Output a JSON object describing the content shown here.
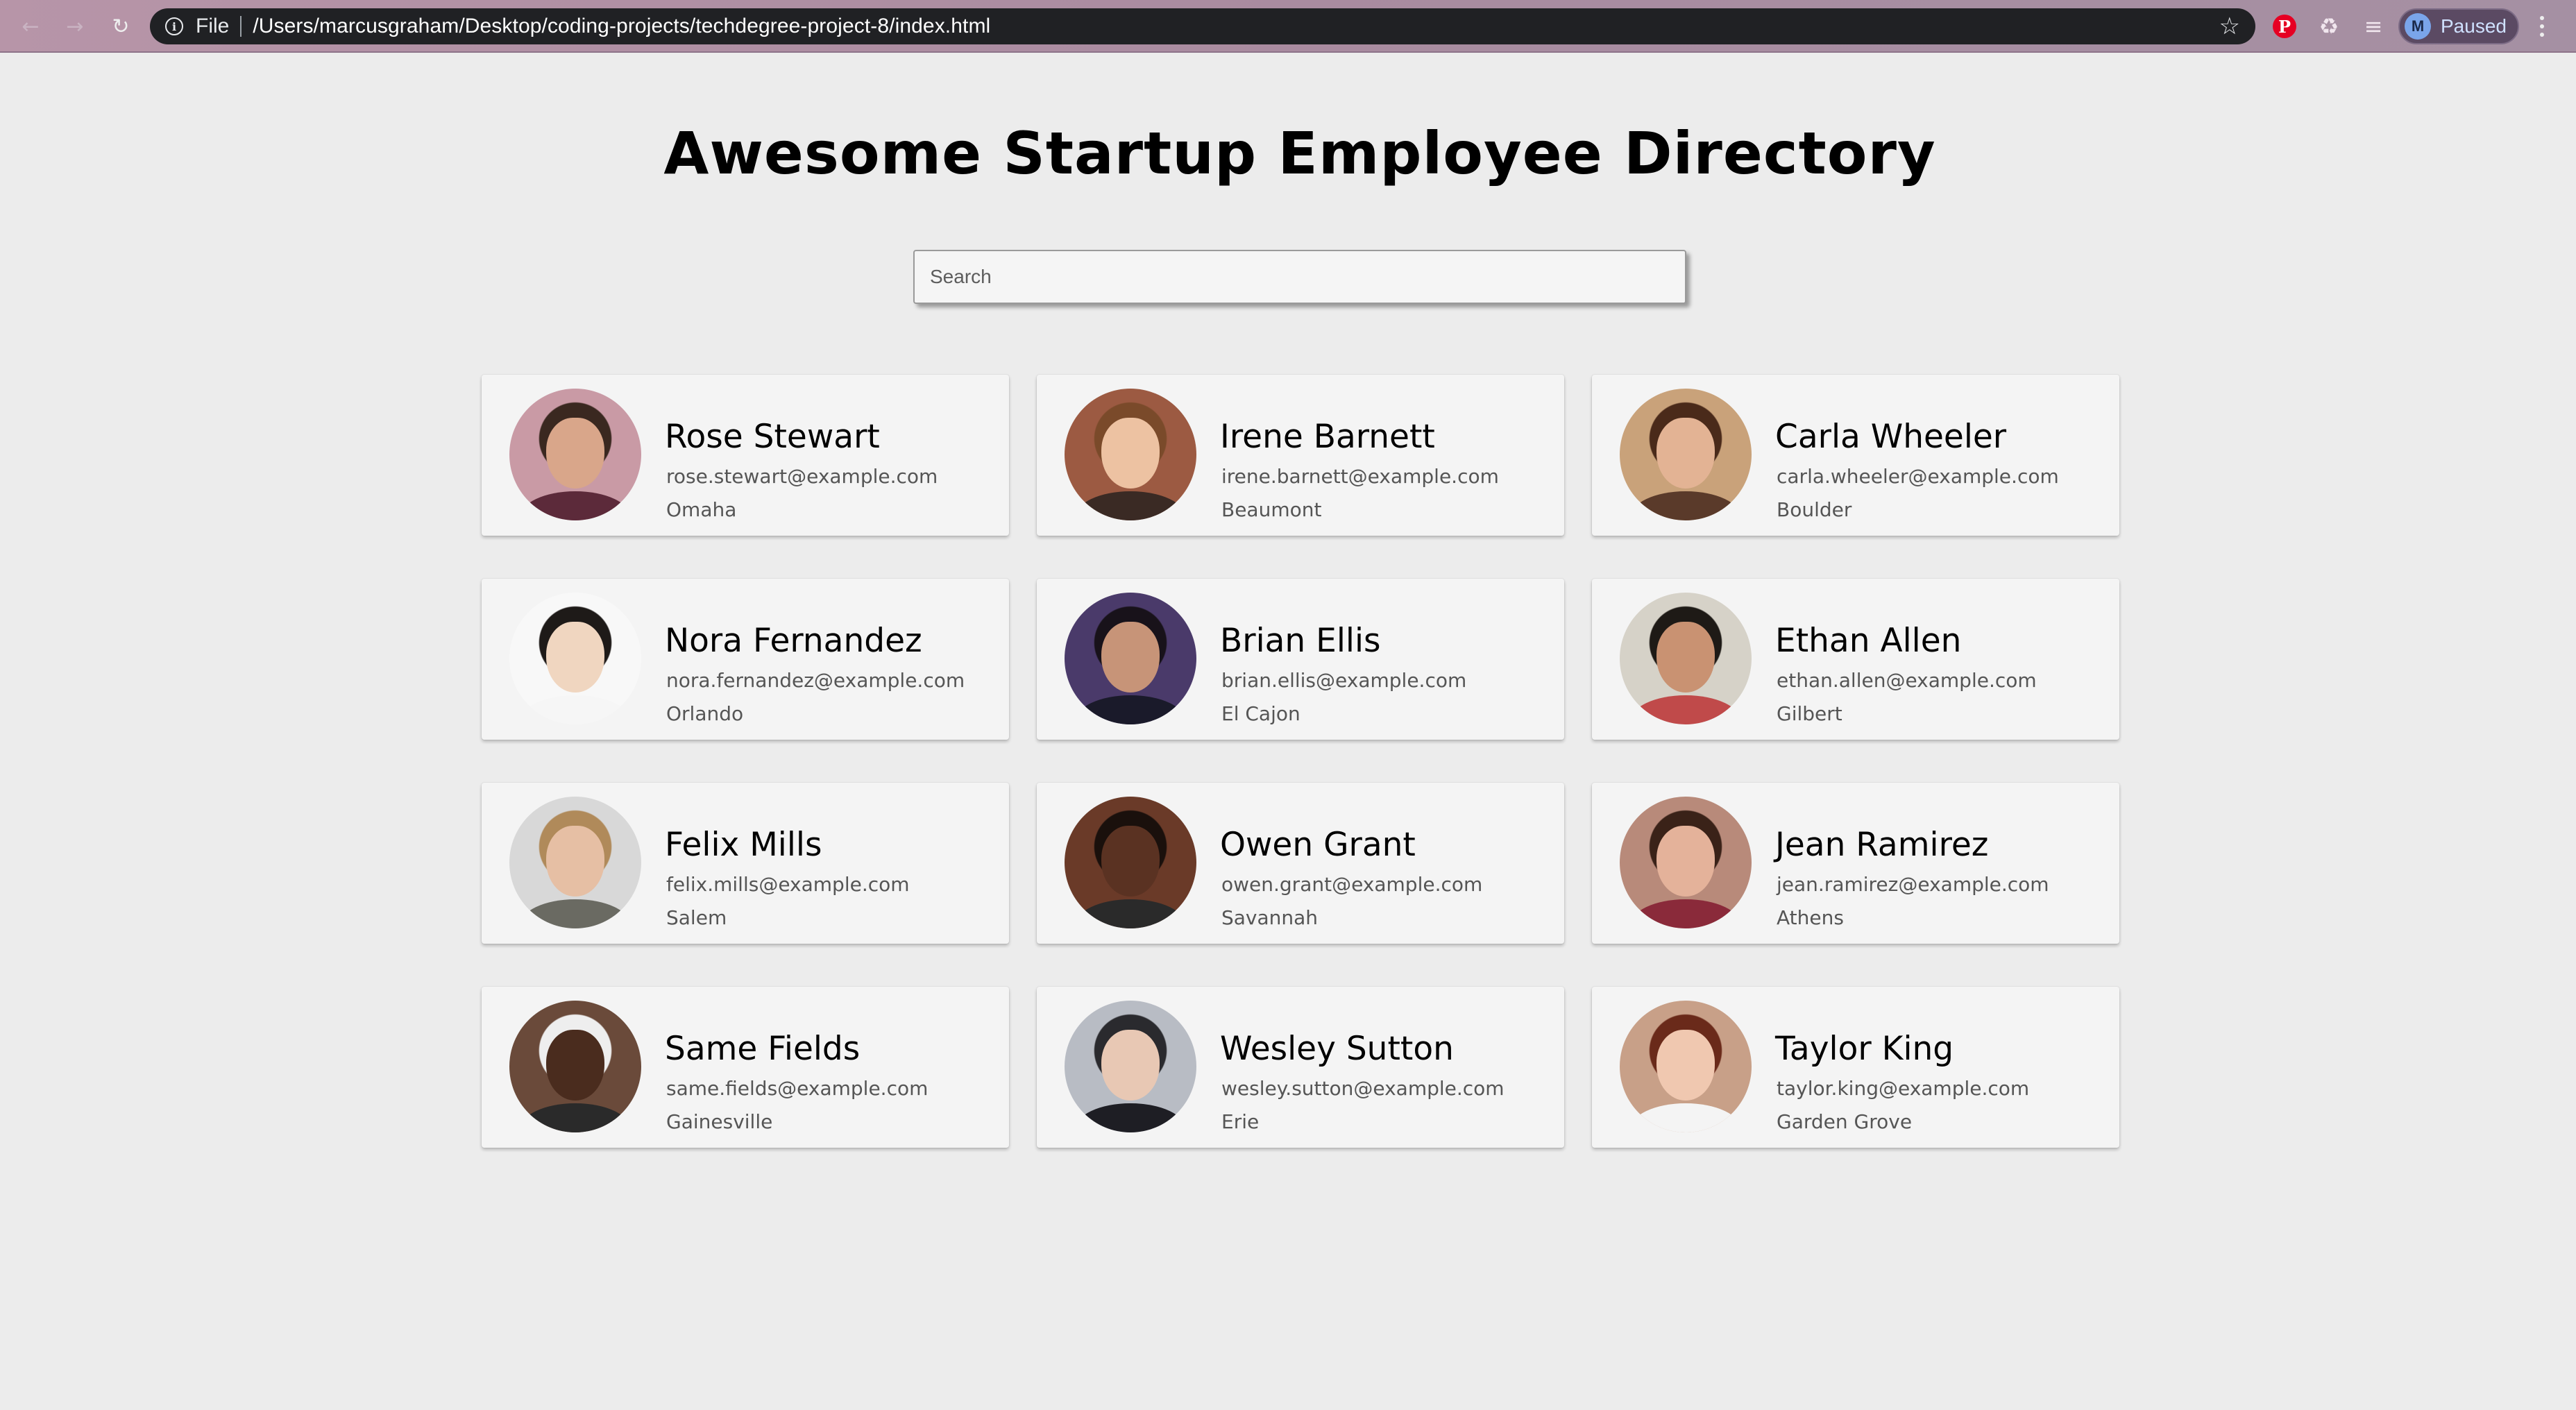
{
  "browser": {
    "scheme_label": "File",
    "url": "/Users/marcusgraham/Desktop/coding-projects/techdegree-project-8/index.html",
    "profile_initial": "M",
    "profile_status": "Paused",
    "back_icon": "arrow-left",
    "forward_icon": "arrow-right",
    "reload_icon": "reload",
    "info_icon": "info",
    "bookmark_icon": "star",
    "extensions": [
      "pinterest-icon",
      "puzzle-icon",
      "media-queue-icon"
    ]
  },
  "page": {
    "title": "Awesome Startup Employee Directory",
    "search_placeholder": "Search",
    "background_color": "#ececec",
    "card_color": "#f4f4f4"
  },
  "employees": [
    {
      "name": "Rose Stewart",
      "email": "rose.stewart@example.com",
      "city": "Omaha",
      "hair": "#3a2820",
      "skin": "#d9a68a",
      "clothes": "#5c2a3a",
      "bg": "#c99aa5"
    },
    {
      "name": "Irene Barnett",
      "email": "irene.barnett@example.com",
      "city": "Beaumont",
      "hair": "#7a4a2a",
      "skin": "#edc2a2",
      "clothes": "#3a2a24",
      "bg": "#9c5a42"
    },
    {
      "name": "Carla Wheeler",
      "email": "carla.wheeler@example.com",
      "city": "Boulder",
      "hair": "#4a2a1a",
      "skin": "#e3b394",
      "clothes": "#5a3a2a",
      "bg": "#c9a27a"
    },
    {
      "name": "Nora Fernandez",
      "email": "nora.fernandez@example.com",
      "city": "Orlando",
      "hair": "#1e1a18",
      "skin": "#f0d6c0",
      "clothes": "#f6f6f6",
      "bg": "#f8f8f8"
    },
    {
      "name": "Brian Ellis",
      "email": "brian.ellis@example.com",
      "city": "El Cajon",
      "hair": "#18121a",
      "skin": "#c79478",
      "clothes": "#1a1a2a",
      "bg": "#4a3a6a"
    },
    {
      "name": "Ethan Allen",
      "email": "ethan.allen@example.com",
      "city": "Gilbert",
      "hair": "#1e1a16",
      "skin": "#c99272",
      "clothes": "#c04a4a",
      "bg": "#d6d2c8"
    },
    {
      "name": "Felix Mills",
      "email": "felix.mills@example.com",
      "city": "Salem",
      "hair": "#b08a5a",
      "skin": "#e6bfa4",
      "clothes": "#6a6a62",
      "bg": "#d8d8d8"
    },
    {
      "name": "Owen Grant",
      "email": "owen.grant@example.com",
      "city": "Savannah",
      "hair": "#1a100c",
      "skin": "#5a3222",
      "clothes": "#2a2a2a",
      "bg": "#6a3a28"
    },
    {
      "name": "Jean Ramirez",
      "email": "jean.ramirez@example.com",
      "city": "Athens",
      "hair": "#3a2218",
      "skin": "#e4b29a",
      "clothes": "#8a2a3a",
      "bg": "#b88a7a"
    },
    {
      "name": "Same Fields",
      "email": "same.fields@example.com",
      "city": "Gainesville",
      "hair": "#eeeeee",
      "skin": "#4a2c1e",
      "clothes": "#2a2a2a",
      "bg": "#6a4a3a"
    },
    {
      "name": "Wesley Sutton",
      "email": "wesley.sutton@example.com",
      "city": "Erie",
      "hair": "#2a2a2e",
      "skin": "#e8c8b4",
      "clothes": "#1e1e24",
      "bg": "#b8bcc4"
    },
    {
      "name": "Taylor King",
      "email": "taylor.king@example.com",
      "city": "Garden Grove",
      "hair": "#6a2a1a",
      "skin": "#f0c8b0",
      "clothes": "#f4f4f4",
      "bg": "#c8a088"
    }
  ]
}
